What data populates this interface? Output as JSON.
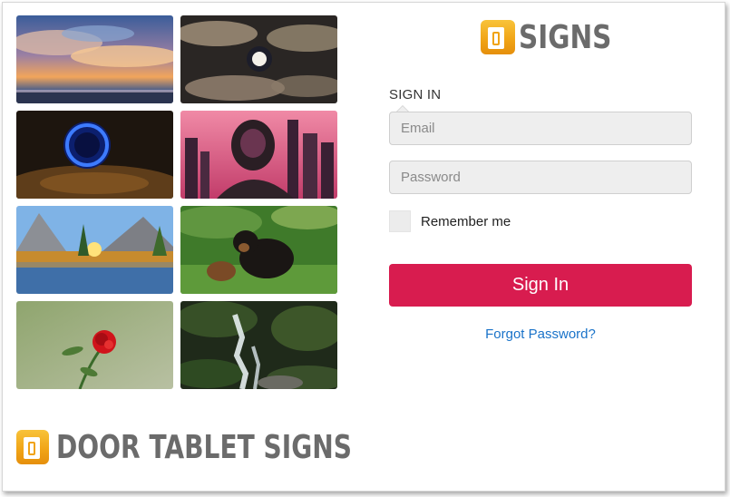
{
  "brand": {
    "top_text": "SIGNS",
    "bottom_text": "DOOR TABLET SIGNS",
    "logo_icon": "door-tablet-logo-icon",
    "logo_color": "#f0a315"
  },
  "gallery": {
    "images": [
      "sunset-clouds-over-sea-image",
      "full-moon-clouds-night-image",
      "blue-portal-cave-image",
      "astronaut-helmet-pink-city-image",
      "mountain-lake-sunrise-image",
      "puppy-on-grass-image",
      "red-rose-image",
      "forest-waterfall-image"
    ]
  },
  "form": {
    "heading": "SIGN IN",
    "email_placeholder": "Email",
    "password_placeholder": "Password",
    "remember_label": "Remember me",
    "remember_checked": false,
    "submit_label": "Sign In",
    "forgot_label": "Forgot Password?"
  },
  "colors": {
    "accent": "#d81c4f",
    "link": "#1a73c9",
    "input_bg": "#eeeeee"
  }
}
